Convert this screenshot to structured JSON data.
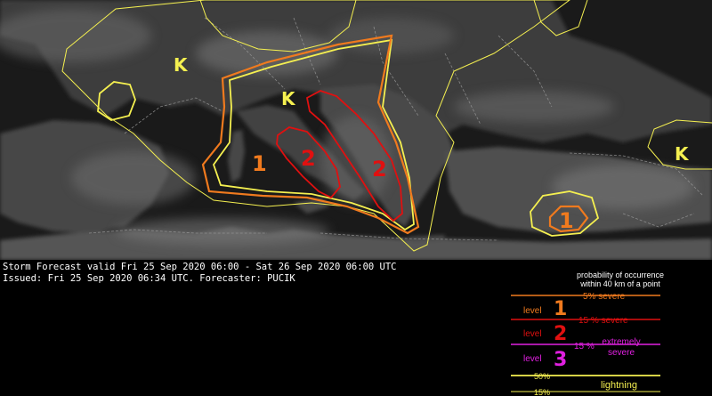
{
  "map": {
    "lightning_symbols": [
      "K",
      "K",
      "K"
    ],
    "area_labels": {
      "italy_level1": "1",
      "tyrrhenian_level2": "2",
      "adriatic_level2": "2",
      "turkey_level1": "1"
    },
    "colors": {
      "level1": "#f07a1e",
      "level2": "#e01010",
      "level3": "#e020e0",
      "lightning": "#f5f050",
      "borders": "#9a9a9a"
    }
  },
  "forecast": {
    "valid_line": "Storm Forecast valid Fri 25 Sep 2020 06:00 - Sat 26 Sep 2020 06:00 UTC",
    "issued_line": "Issued: Fri 25 Sep 2020 06:34 UTC. Forecaster: PUCIK"
  },
  "legend": {
    "header_line1": "probability of occurrence",
    "header_line2": "within 40 km of a point",
    "level1": {
      "word": "level",
      "number": "1",
      "text": "5% severe"
    },
    "level2": {
      "word": "level",
      "number": "2",
      "text": "15 % severe"
    },
    "level3": {
      "word": "level",
      "number": "3",
      "text": "15 %",
      "text_b": "extremely",
      "text_c": "severe"
    },
    "lightning": {
      "p50": "50%",
      "p15": "15%",
      "label": "lightning"
    }
  }
}
